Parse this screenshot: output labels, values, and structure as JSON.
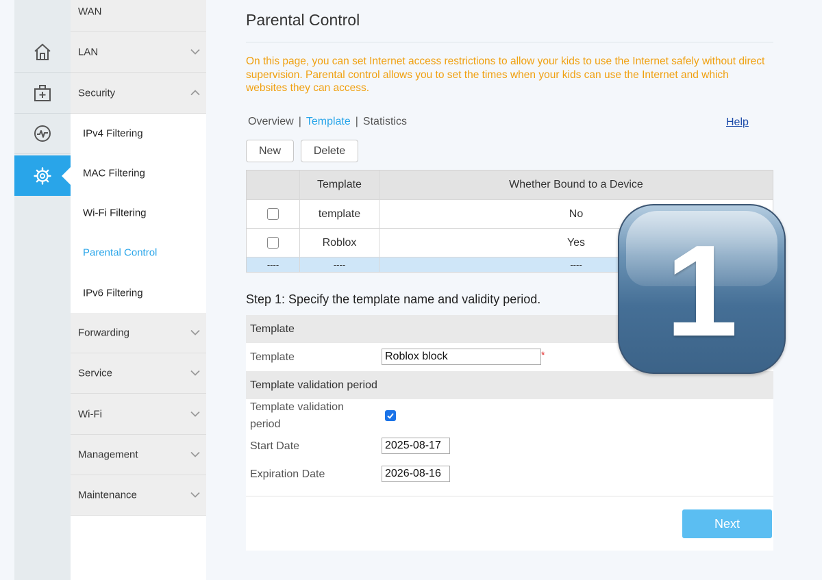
{
  "rail": {
    "items": [
      {
        "icon": "home-icon"
      },
      {
        "icon": "first-aid-kit-icon"
      },
      {
        "icon": "activity-monitor-icon"
      },
      {
        "icon": "gear-icon",
        "active": true
      }
    ],
    "accent": "#29a5e9"
  },
  "menu": {
    "wan": "WAN",
    "lan": "LAN",
    "security": "Security",
    "security_children": {
      "ipv4": "IPv4 Filtering",
      "mac": "MAC Filtering",
      "wifi": "Wi-Fi Filtering",
      "parental": "Parental Control",
      "ipv6": "IPv6 Filtering"
    },
    "forwarding": "Forwarding",
    "service": "Service",
    "wifi": "Wi-Fi",
    "management": "Management",
    "maintenance": "Maintenance"
  },
  "page": {
    "title": "Parental Control",
    "description": "On this page, you can set Internet access restrictions to allow your kids to use the Internet safely without direct supervision. Parental control allows you to set the times when your kids can use the Internet and which websites they can access.",
    "description_color": "#f0a010"
  },
  "tabs": {
    "overview": "Overview",
    "template": "Template",
    "statistics": "Statistics",
    "separator": "|",
    "active": "Template"
  },
  "help": "Help",
  "buttons": {
    "new": "New",
    "delete": "Delete",
    "next": "Next"
  },
  "table": {
    "headers": {
      "template": "Template",
      "bound": "Whether Bound to a Device"
    },
    "rows": [
      {
        "template": "template",
        "bound": "No"
      },
      {
        "template": "Roblox",
        "bound": "Yes"
      }
    ],
    "new_row": {
      "c1": "----",
      "c2": "----",
      "c3": "----"
    }
  },
  "step": {
    "heading": "Step 1: Specify the template name and validity period."
  },
  "form": {
    "section_template": "Template",
    "template_label": "Template",
    "template_value": "Roblox block",
    "required_mark": "*",
    "section_validation": "Template validation period",
    "validation_label": "Template validation period",
    "validation_checked": true,
    "start_label": "Start Date",
    "start_value": "2025-08-17",
    "expiration_label": "Expiration Date",
    "expiration_value": "2026-08-16"
  },
  "badge": {
    "number": "1"
  }
}
